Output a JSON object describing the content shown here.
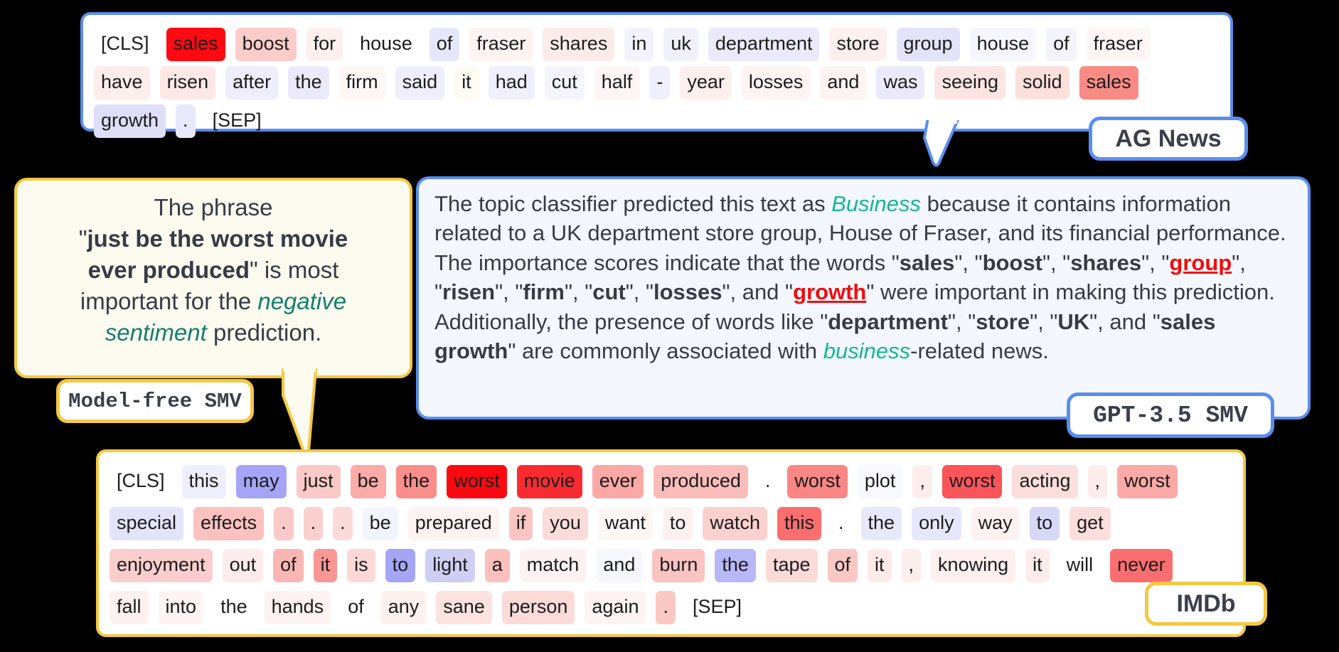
{
  "panels": {
    "agnews": {
      "dataset_label": "AG News",
      "rows": [
        [
          {
            "t": "[CLS]",
            "c": "transparent"
          },
          {
            "t": "sales",
            "c": "#ff0a10"
          },
          {
            "t": "boost",
            "c": "#fccccb"
          },
          {
            "t": "for",
            "c": "#fdf0ef"
          },
          {
            "t": "house",
            "c": "#ffffff"
          },
          {
            "t": "of",
            "c": "#e7e7fb"
          },
          {
            "t": "fraser",
            "c": "#fdf3f2"
          },
          {
            "t": "shares",
            "c": "#fcece9"
          },
          {
            "t": "in",
            "c": "#f3f3fd"
          },
          {
            "t": "uk",
            "c": "#f1f1fc"
          },
          {
            "t": "department",
            "c": "#eaeafb"
          },
          {
            "t": "store",
            "c": "#fdf0ee"
          },
          {
            "t": "group",
            "c": "#e3e3fa"
          },
          {
            "t": "house",
            "c": "#f6f6fe"
          },
          {
            "t": "of",
            "c": "#f4f4fd"
          },
          {
            "t": "fraser",
            "c": "#fdf6f5"
          }
        ],
        [
          {
            "t": "have",
            "c": "#fdeeec"
          },
          {
            "t": "risen",
            "c": "#fce8e5"
          },
          {
            "t": "after",
            "c": "#eeeefc"
          },
          {
            "t": "the",
            "c": "#eaeafb"
          },
          {
            "t": "firm",
            "c": "#fdf7f6"
          },
          {
            "t": "said",
            "c": "#eeeefc"
          },
          {
            "t": "it",
            "c": "#fefbf2"
          },
          {
            "t": "had",
            "c": "#f0f0fc"
          },
          {
            "t": "cut",
            "c": "#f4f4fd"
          },
          {
            "t": "half",
            "c": "#fdf6f5"
          },
          {
            "t": "-",
            "c": "#f0f0fc"
          },
          {
            "t": "year",
            "c": "#fdf0ee"
          },
          {
            "t": "losses",
            "c": "#fdf4f3"
          },
          {
            "t": "and",
            "c": "#fdf3f2"
          },
          {
            "t": "was",
            "c": "#eaeafb"
          },
          {
            "t": "seeing",
            "c": "#fce6e3"
          },
          {
            "t": "solid",
            "c": "#fce0dc"
          },
          {
            "t": "sales",
            "c": "#f98b85"
          }
        ],
        [
          {
            "t": "growth",
            "c": "#dedef9"
          },
          {
            "t": ".",
            "c": "#e8e8fb"
          },
          {
            "t": "[SEP]",
            "c": "transparent"
          }
        ]
      ]
    },
    "imdb": {
      "dataset_label": "IMDb",
      "rows": [
        [
          {
            "t": "[CLS]",
            "c": "transparent"
          },
          {
            "t": "this",
            "c": "#eeeefd"
          },
          {
            "t": "may",
            "c": "#a5a5f7"
          },
          {
            "t": "just",
            "c": "#fbc9c7"
          },
          {
            "t": "be",
            "c": "#fbaba8"
          },
          {
            "t": "the",
            "c": "#fa8e8b"
          },
          {
            "t": "worst",
            "c": "#fa0a10"
          },
          {
            "t": "movie",
            "c": "#fa2b30"
          },
          {
            "t": "ever",
            "c": "#fba9a6"
          },
          {
            "t": "produced",
            "c": "#fbbcba"
          },
          {
            "t": ".",
            "c": "#ffffff"
          },
          {
            "t": "worst",
            "c": "#fa8784"
          },
          {
            "t": "plot",
            "c": "#f8f9fe"
          },
          {
            "t": ",",
            "c": "#fdeeed"
          },
          {
            "t": "worst",
            "c": "#fb5459"
          },
          {
            "t": "acting",
            "c": "#fcdedd"
          },
          {
            "t": ",",
            "c": "#fdecec"
          },
          {
            "t": "worst",
            "c": "#fba9a6"
          }
        ],
        [
          {
            "t": "special",
            "c": "#e3e3fa"
          },
          {
            "t": "effects",
            "c": "#fbc2c0"
          },
          {
            "t": ".",
            "c": "#fbcac8"
          },
          {
            "t": ".",
            "c": "#fbcfcd"
          },
          {
            "t": ".",
            "c": "#fcdad8"
          },
          {
            "t": "be",
            "c": "#f3f5fd"
          },
          {
            "t": "prepared",
            "c": "#fdf3f2"
          },
          {
            "t": "if",
            "c": "#fbc5c3"
          },
          {
            "t": "you",
            "c": "#fcdcda"
          },
          {
            "t": "want",
            "c": "#fdf7f6"
          },
          {
            "t": "to",
            "c": "#fdf1f0"
          },
          {
            "t": "watch",
            "c": "#fcd0ce"
          },
          {
            "t": "this",
            "c": "#fb6e70"
          },
          {
            "t": ".",
            "c": "#ffffff"
          },
          {
            "t": "the",
            "c": "#e8e8fb"
          },
          {
            "t": "only",
            "c": "#e7e7fb"
          },
          {
            "t": "way",
            "c": "#fdf2f1"
          },
          {
            "t": "to",
            "c": "#d7d7f7"
          },
          {
            "t": "get",
            "c": "#fcdedd"
          }
        ],
        [
          {
            "t": "enjoyment",
            "c": "#fbcecd"
          },
          {
            "t": "out",
            "c": "#fdeceb"
          },
          {
            "t": "of",
            "c": "#fbb6b4"
          },
          {
            "t": "it",
            "c": "#fa9795"
          },
          {
            "t": "is",
            "c": "#fcd8d6"
          },
          {
            "t": "to",
            "c": "#a5a5f7"
          },
          {
            "t": "light",
            "c": "#cfcff4"
          },
          {
            "t": "a",
            "c": "#fbbfbd"
          },
          {
            "t": "match",
            "c": "#fdf2f1"
          },
          {
            "t": "and",
            "c": "#f7f7fe"
          },
          {
            "t": "burn",
            "c": "#fbc3c1"
          },
          {
            "t": "the",
            "c": "#b7b7f9"
          },
          {
            "t": "tape",
            "c": "#fcdbd9"
          },
          {
            "t": "of",
            "c": "#fbc7c5"
          },
          {
            "t": "it",
            "c": "#fdeae9"
          },
          {
            "t": ",",
            "c": "#fceeed"
          },
          {
            "t": "knowing",
            "c": "#fdf0ef"
          },
          {
            "t": "it",
            "c": "#fdeceb"
          },
          {
            "t": "will",
            "c": "#ffffff"
          },
          {
            "t": "never",
            "c": "#fb6e70"
          }
        ],
        [
          {
            "t": "fall",
            "c": "#fdf2f1"
          },
          {
            "t": "into",
            "c": "#fdf4f3"
          },
          {
            "t": "the",
            "c": "#ffffff"
          },
          {
            "t": "hands",
            "c": "#fdf3f2"
          },
          {
            "t": "of",
            "c": "#ffffff"
          },
          {
            "t": "any",
            "c": "#fdf1f0"
          },
          {
            "t": "sane",
            "c": "#fce3e1"
          },
          {
            "t": "person",
            "c": "#fcdbd9"
          },
          {
            "t": "again",
            "c": "#fdf4f3"
          },
          {
            "t": ".",
            "c": "#fbc8c6"
          },
          {
            "t": "[SEP]",
            "c": "transparent"
          }
        ]
      ]
    }
  },
  "bubbles": {
    "model_free": {
      "badge_label": "Model-free SMV",
      "line1_plain": "The phrase",
      "quote_open": "\"",
      "highlight_line1": "just be the worst movie",
      "highlight_line2": "ever produced",
      "quote_close": "\"",
      "after_quote": " is most",
      "line3": "important for the ",
      "emph1": "negative",
      "emph2": "sentiment",
      "tail_end": " prediction."
    },
    "gpt": {
      "badge_label": "GPT-3.5 SMV",
      "seg_1": "The topic classifier predicted this text as ",
      "pred_label": "Business",
      "seg_2": " because it contains information related to a UK department store group, House of Fraser, and its financial performance. The importance scores indicate that the words ",
      "w1": "sales",
      "w2": "boost",
      "w3": "shares",
      "w4": "group",
      "w5": "risen",
      "w6": "firm",
      "w7": "cut",
      "w8": "losses",
      "w9": "growth",
      "seg_3": " were important in making this prediction. Additionally, the presence of words like ",
      "w10": "department",
      "w11": "store",
      "w12": "UK",
      "w13": "sales growth",
      "seg_4": " are commonly associated with ",
      "topic_word": "business",
      "seg_5": "-related news."
    }
  },
  "colors": {
    "blue_border": "#5b8def",
    "yellow_border": "#f5c842",
    "teal_accent": "#12b894",
    "teal_dark": "#12806b",
    "red_accent": "#f00d0d",
    "text_dark": "#363b45"
  }
}
